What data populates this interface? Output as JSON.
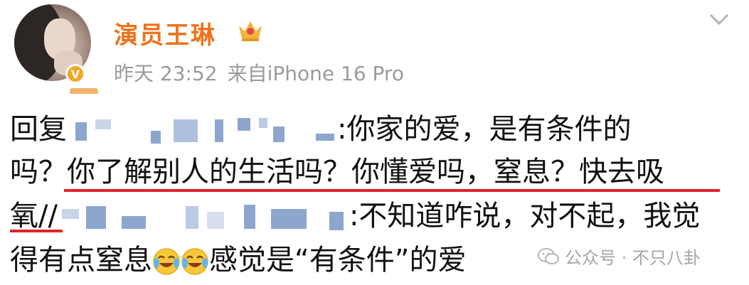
{
  "post": {
    "author": "演员王琳",
    "time": "昨天 23:52",
    "source": "来自iPhone 16 Pro"
  },
  "content": {
    "line1_prefix": "回复",
    "line1_suffix": ":你家的爱，是有条件的",
    "line2": "吗？你了解别人的生活吗？你懂爱吗，窒息？快去吸",
    "line3_prefix": "氧//",
    "line3_suffix": ":不知道咋说，对不起，我觉",
    "line4_a": "得有点窒息",
    "line4_b": "感觉是“有条件”的爱"
  },
  "watermark": {
    "text": "公众号 · 不只八卦"
  },
  "icons": [
    "avatar",
    "verified-badge-icon",
    "crown-icon",
    "chevron-down-icon",
    "crying-laugh-emoji-icon",
    "wechat-icon"
  ],
  "colors": {
    "name": "#f0721b",
    "meta": "#9b9b9b",
    "underline": "#e2222c",
    "mosaic": "#7a96c6"
  }
}
